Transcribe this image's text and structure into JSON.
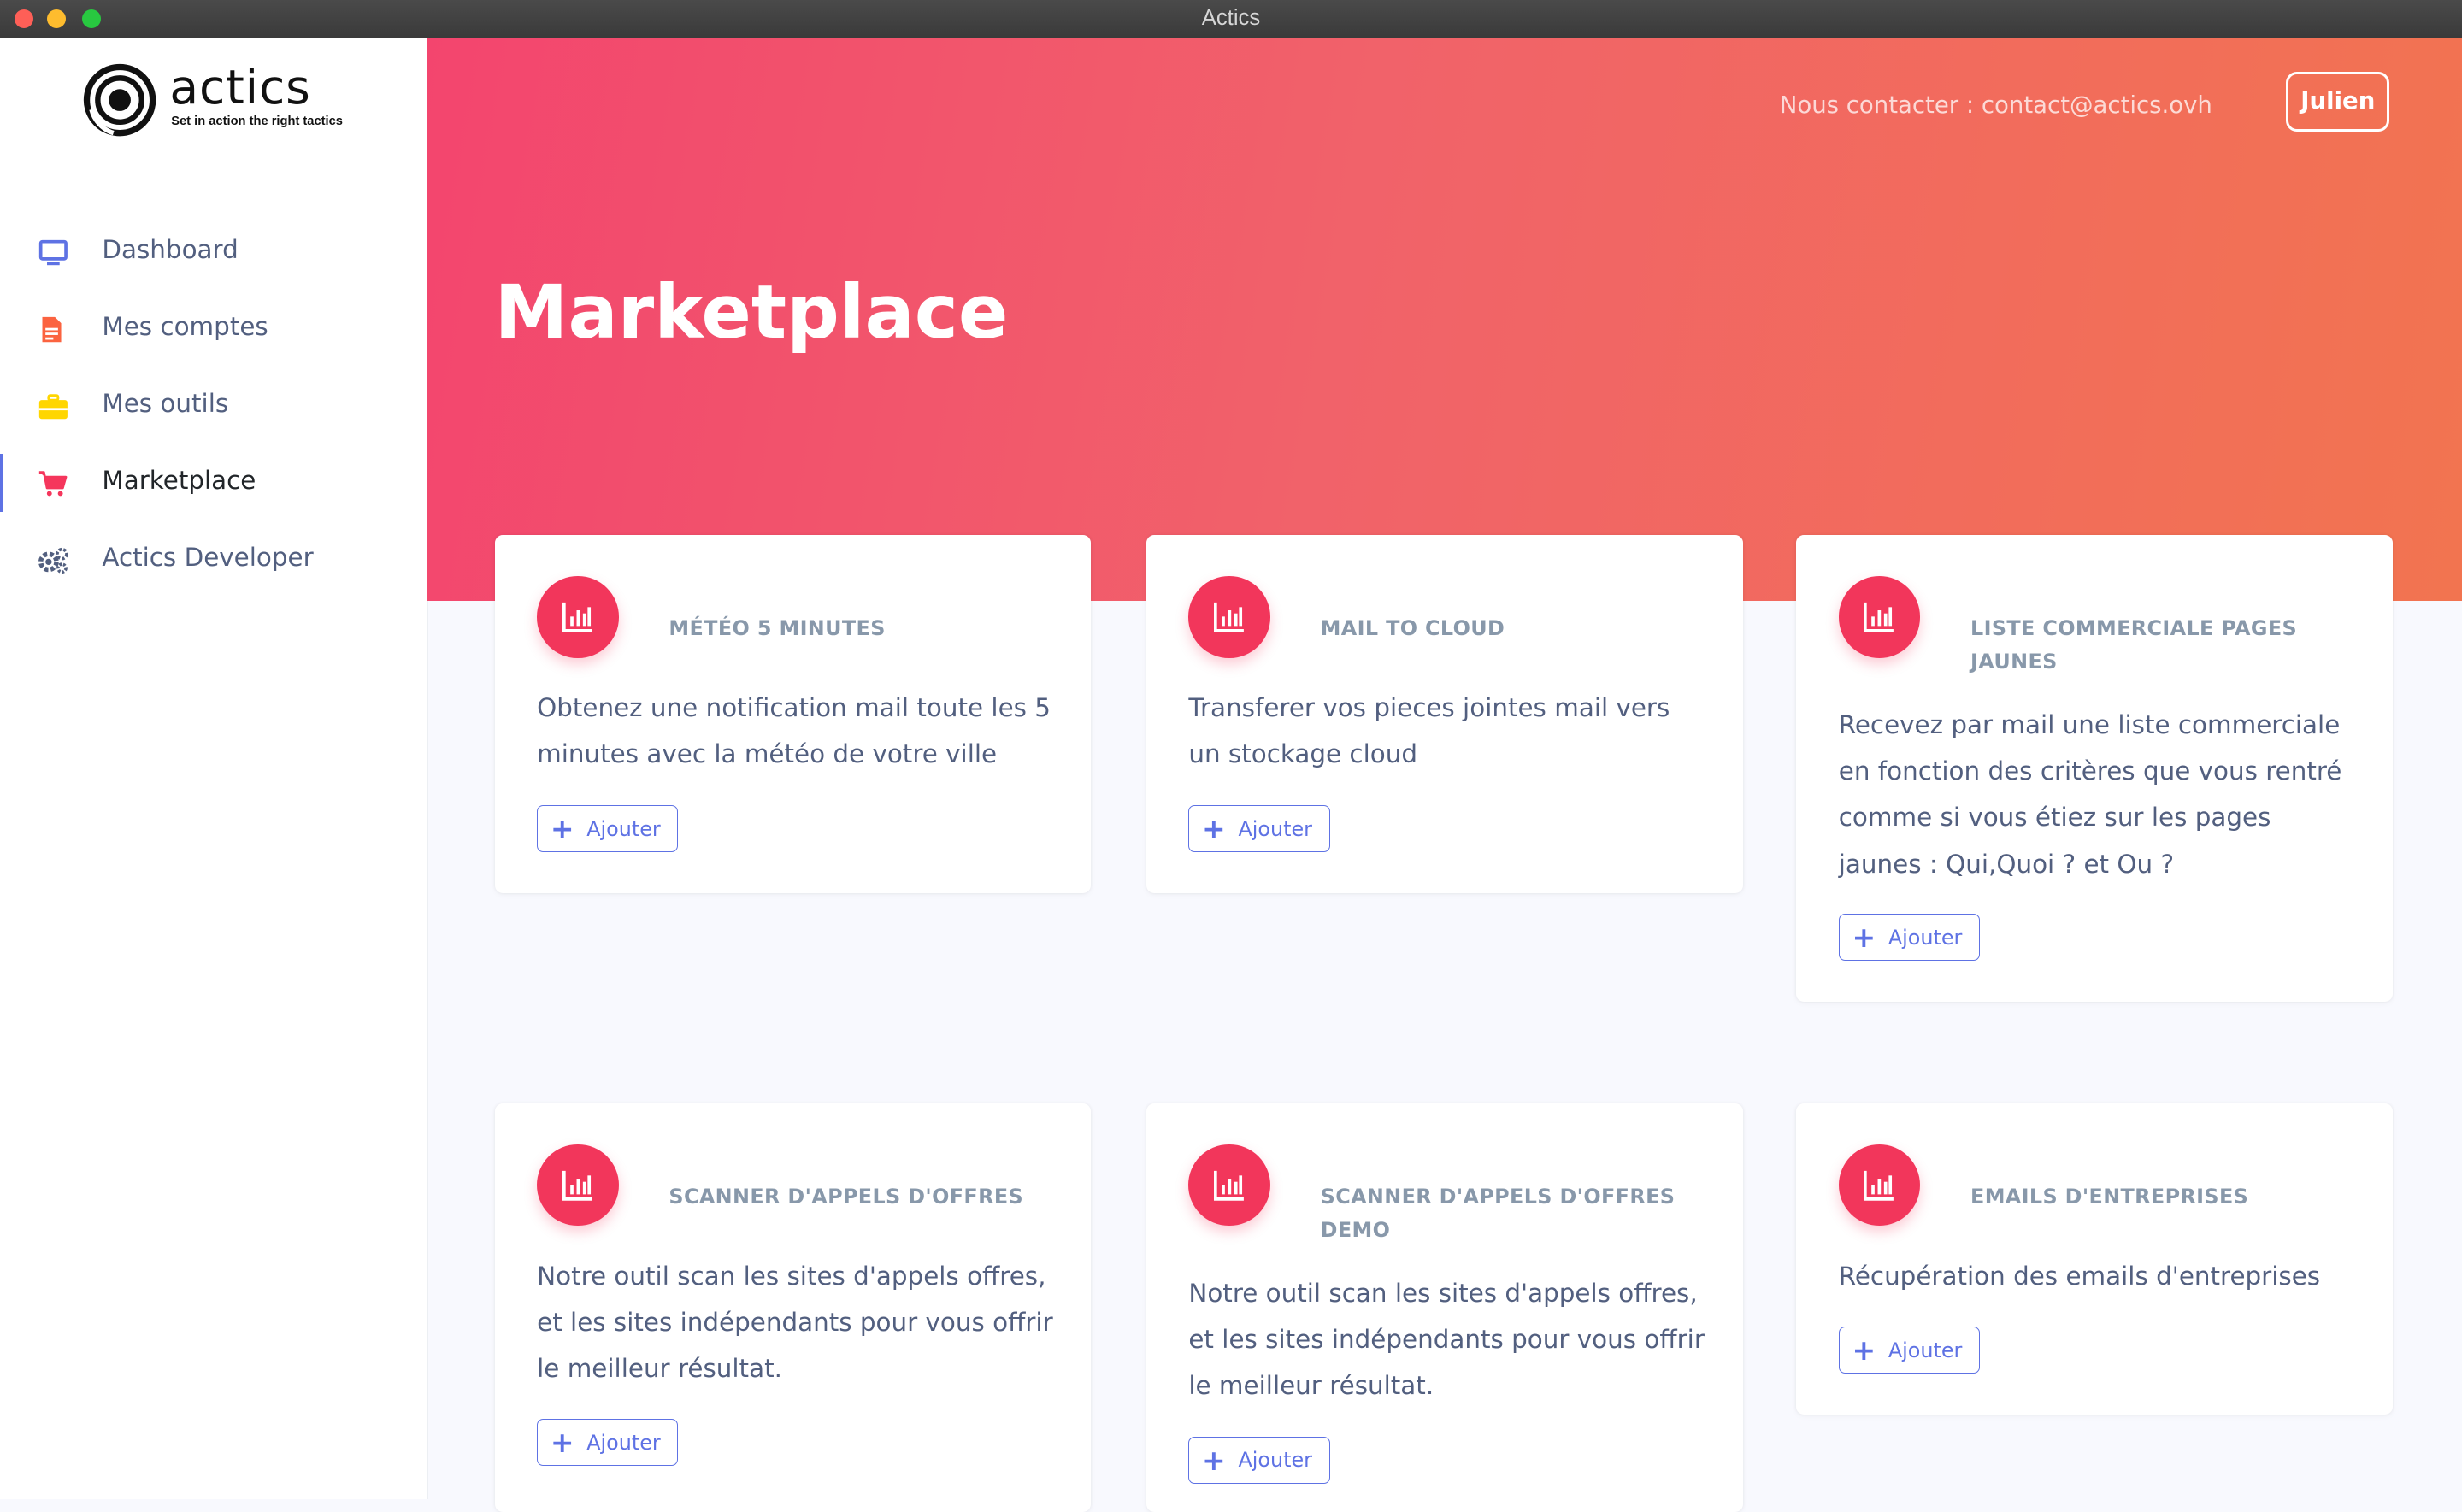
{
  "window": {
    "title": "Actics"
  },
  "brand": {
    "name": "actics",
    "tagline": "Set in action the right tactics"
  },
  "sidebar": {
    "items": [
      {
        "label": "Dashboard",
        "icon": "monitor-icon",
        "color": "#5e72e4"
      },
      {
        "label": "Mes comptes",
        "icon": "document-icon",
        "color": "#fb6340"
      },
      {
        "label": "Mes outils",
        "icon": "toolbox-icon",
        "color": "#ffd600"
      },
      {
        "label": "Marketplace",
        "icon": "cart-icon",
        "color": "#f5365c",
        "active": true
      },
      {
        "label": "Actics Developer",
        "icon": "gears-icon",
        "color": "#525f7f"
      }
    ]
  },
  "header": {
    "contact": "Nous contacter : contact@actics.ovh",
    "user": "Julien",
    "title": "Marketplace"
  },
  "cards": [
    {
      "title": "MÉTÉO 5 MINUTES",
      "description": "Obtenez une notification mail toute les 5 minutes avec la météo de votre ville",
      "button": "Ajouter"
    },
    {
      "title": "MAIL TO CLOUD",
      "description": "Transferer vos pieces jointes mail vers un stockage cloud",
      "button": "Ajouter"
    },
    {
      "title": "LISTE COMMERCIALE PAGES JAUNES",
      "description": "Recevez par mail une liste commerciale en fonction des critères que vous rentré comme si vous étiez sur les pages jaunes : Qui,Quoi ? et Ou ?",
      "button": "Ajouter"
    },
    {
      "title": "SCANNER D'APPELS D'OFFRES",
      "description": "Notre outil scan les sites d'appels offres, et les sites indépendants pour vous offrir le meilleur résultat.",
      "button": "Ajouter"
    },
    {
      "title": "SCANNER D'APPELS D'OFFRES DEMO",
      "description": "Notre outil scan les sites d'appels offres, et les sites indépendants pour vous offrir le meilleur résultat.",
      "button": "Ajouter"
    },
    {
      "title": "EMAILS D'ENTREPRISES",
      "description": "Récupération des emails d'entreprises",
      "button": "Ajouter"
    }
  ],
  "colors": {
    "accent": "#5e72e4",
    "card_icon": "#f2365b",
    "header_start": "#f3456e",
    "header_end": "#f27450"
  }
}
